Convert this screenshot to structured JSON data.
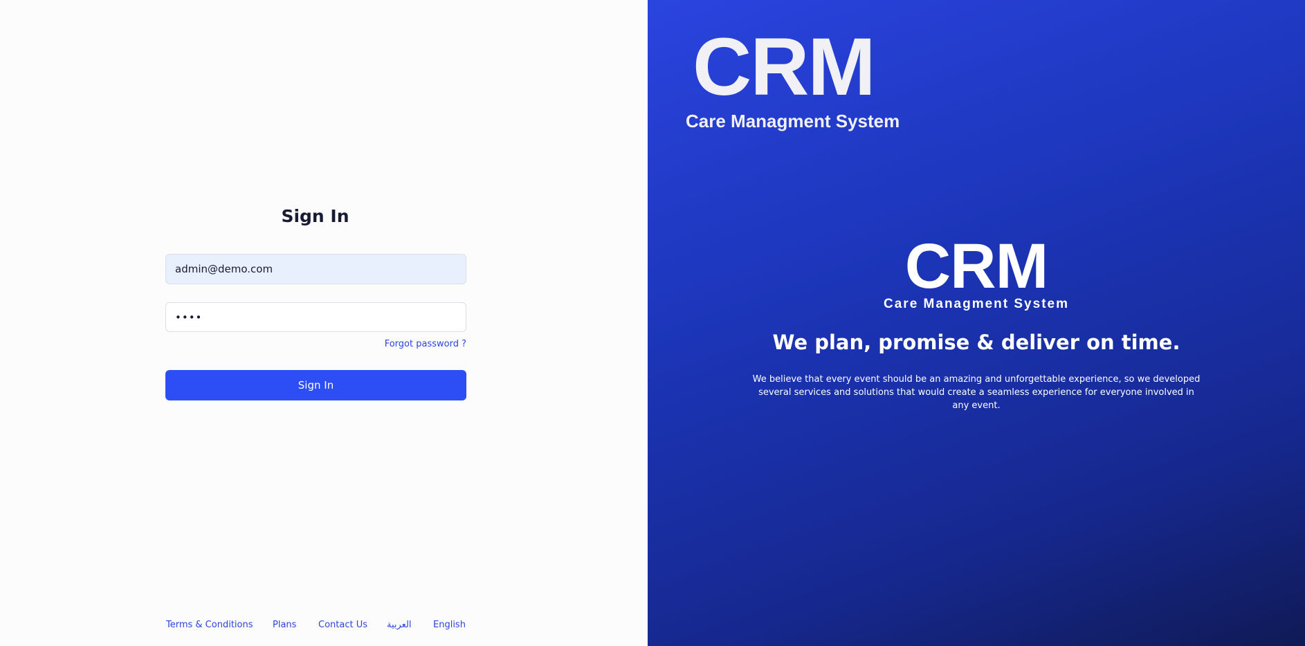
{
  "signin": {
    "title": "Sign In",
    "email_value": "admin@demo.com",
    "password_value": "••••",
    "forgot_label": "Forgot password ?",
    "submit_label": "Sign In"
  },
  "footer": {
    "terms": "Terms & Conditions",
    "plans": "Plans",
    "contact": "Contact Us",
    "arabic": "العربية",
    "english": "English"
  },
  "brand": {
    "logo_big": "CRM",
    "logo_small": "Care Managment System",
    "tagline": "We plan, promise & deliver on time.",
    "description": "We believe that every event should be an amazing and unforgettable experience, so we developed several services and solutions that would create a seamless experience for everyone involved in any event."
  },
  "colors": {
    "primary": "#2e4ef5",
    "link": "#2b44e0",
    "panel_start": "#2a44df",
    "panel_end": "#101a56"
  }
}
